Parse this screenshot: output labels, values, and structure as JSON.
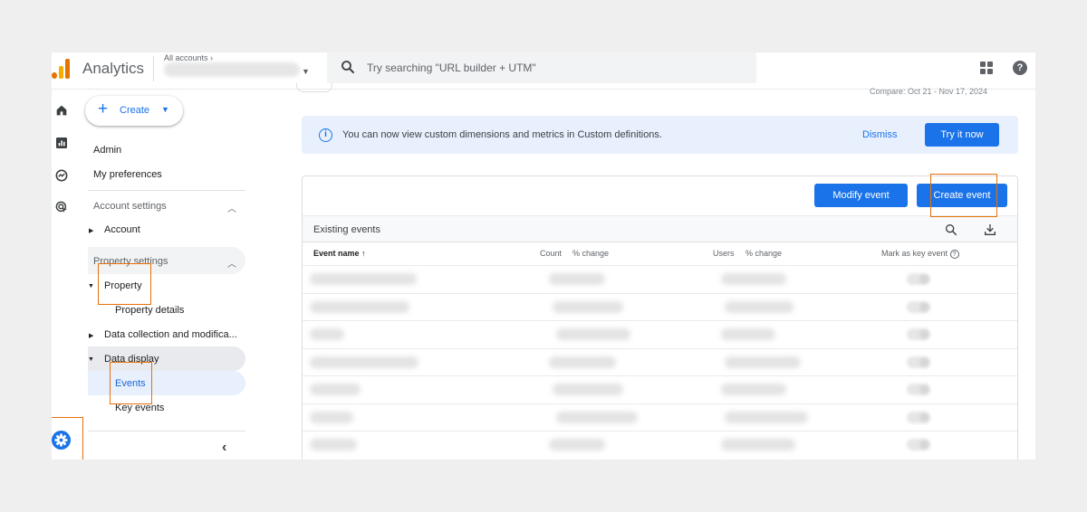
{
  "topbar": {
    "app_name": "Analytics",
    "account_label": "All accounts ›",
    "search_placeholder": "Try searching \"URL builder + UTM\""
  },
  "nav": {
    "create_label": "Create",
    "admin": "Admin",
    "my_preferences": "My preferences",
    "account_settings": "Account settings",
    "account": "Account",
    "property_settings": "Property settings",
    "property": "Property",
    "property_details": "Property details",
    "data_collection": "Data collection and modifica...",
    "data_display": "Data display",
    "events": "Events",
    "key_events": "Key events"
  },
  "main": {
    "compare_text": "Compare: Oct 21 - Nov 17, 2024",
    "banner_text": "You can now view custom dimensions and metrics in Custom definitions.",
    "dismiss": "Dismiss",
    "try_it_now": "Try it now",
    "modify_event": "Modify event",
    "create_event": "Create event",
    "existing_events": "Existing events",
    "columns": {
      "event_name": "Event name",
      "count": "Count",
      "count_change": "% change",
      "users": "Users",
      "users_change": "% change",
      "mark_key": "Mark as key event"
    },
    "row_count": 7
  },
  "colors": {
    "accent_blue": "#1a73e8",
    "highlight_orange": "#e8710a",
    "logo_orange": "#f9ab00",
    "logo_dark_orange": "#e37400"
  },
  "icons": [
    "analytics-logo-icon",
    "search-icon",
    "apps-grid-icon",
    "help-icon",
    "home-icon",
    "reports-icon",
    "explore-icon",
    "advertising-icon",
    "settings-gear-icon",
    "info-icon",
    "download-icon",
    "chevron-left-icon"
  ]
}
